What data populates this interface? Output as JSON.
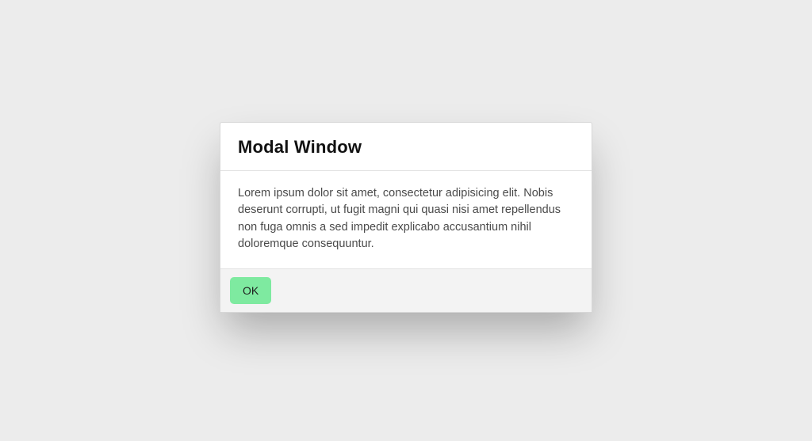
{
  "modal": {
    "title": "Modal Window",
    "body": "Lorem ipsum dolor sit amet, consectetur adipisicing elit. Nobis deserunt corrupti, ut fugit magni qui quasi nisi amet repellendus non fuga omnis a sed impedit explicabo accusantium nihil doloremque consequuntur.",
    "ok_label": "OK"
  }
}
